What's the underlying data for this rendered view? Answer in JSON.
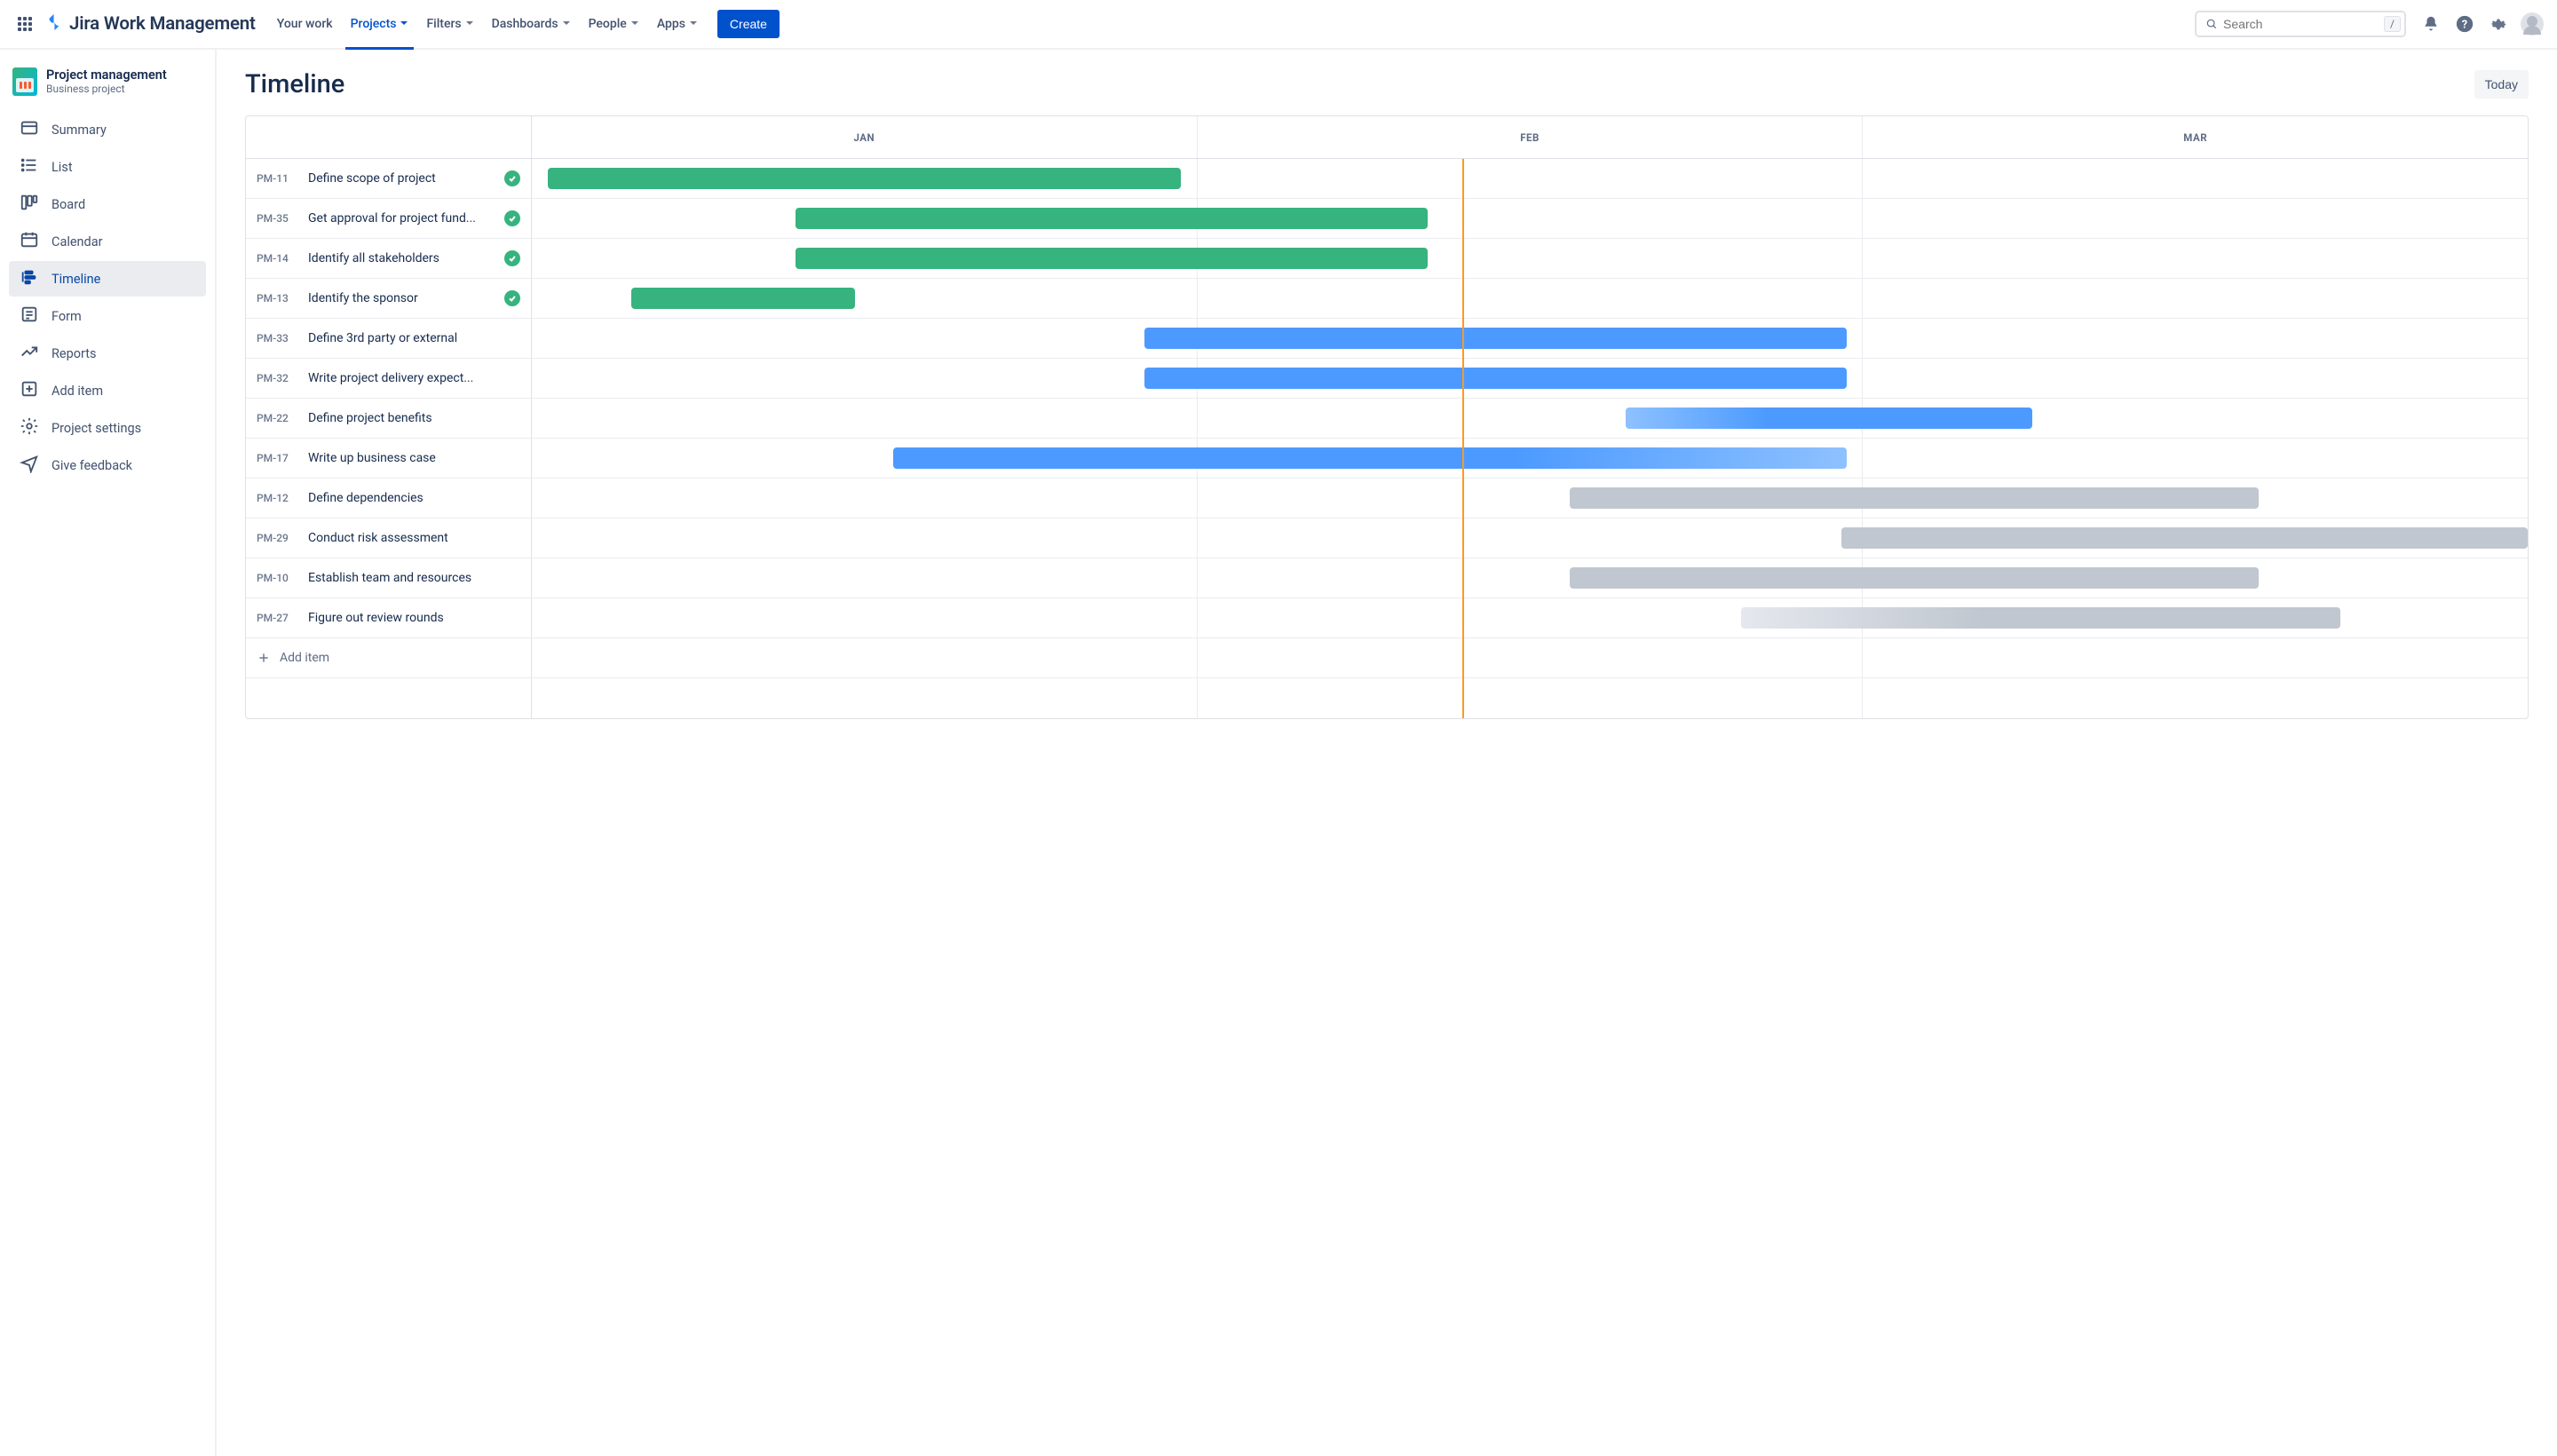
{
  "app": {
    "name": "Jira Work Management"
  },
  "nav": {
    "items": [
      {
        "label": "Your work",
        "dropdown": false
      },
      {
        "label": "Projects",
        "dropdown": true,
        "active": true
      },
      {
        "label": "Filters",
        "dropdown": true
      },
      {
        "label": "Dashboards",
        "dropdown": true
      },
      {
        "label": "People",
        "dropdown": true
      },
      {
        "label": "Apps",
        "dropdown": true
      }
    ],
    "create": "Create"
  },
  "search": {
    "placeholder": "Search",
    "shortcut": "/"
  },
  "project": {
    "name": "Project management",
    "type": "Business project"
  },
  "sidebar": {
    "items": [
      {
        "label": "Summary"
      },
      {
        "label": "List"
      },
      {
        "label": "Board"
      },
      {
        "label": "Calendar"
      },
      {
        "label": "Timeline",
        "selected": true
      },
      {
        "label": "Form"
      },
      {
        "label": "Reports"
      },
      {
        "label": "Add item"
      },
      {
        "label": "Project settings"
      },
      {
        "label": "Give feedback"
      }
    ]
  },
  "page": {
    "title": "Timeline",
    "today_btn": "Today",
    "add_item": "Add item"
  },
  "months": [
    "JAN",
    "FEB",
    "MAR"
  ],
  "today_position_pct": 46.6,
  "tasks": [
    {
      "key": "PM-11",
      "title": "Define scope of project",
      "done": true,
      "style": "green",
      "start_pct": 0.8,
      "width_pct": 31.7
    },
    {
      "key": "PM-35",
      "title": "Get approval for project fund...",
      "done": true,
      "style": "green",
      "start_pct": 13.2,
      "width_pct": 31.7
    },
    {
      "key": "PM-14",
      "title": "Identify all stakeholders",
      "done": true,
      "style": "green",
      "start_pct": 13.2,
      "width_pct": 31.7
    },
    {
      "key": "PM-13",
      "title": "Identify the sponsor",
      "done": true,
      "style": "green",
      "start_pct": 5.0,
      "width_pct": 11.2
    },
    {
      "key": "PM-33",
      "title": "Define 3rd party or external",
      "done": false,
      "style": "blue",
      "start_pct": 30.7,
      "width_pct": 35.2
    },
    {
      "key": "PM-32",
      "title": "Write project delivery expect...",
      "done": false,
      "style": "blue",
      "start_pct": 30.7,
      "width_pct": 35.2
    },
    {
      "key": "PM-22",
      "title": "Define project benefits",
      "done": false,
      "style": "blue-grad",
      "start_pct": 54.8,
      "width_pct": 20.4
    },
    {
      "key": "PM-17",
      "title": "Write up business case",
      "done": false,
      "style": "blue-fade",
      "start_pct": 18.1,
      "width_pct": 47.8
    },
    {
      "key": "PM-12",
      "title": "Define dependencies",
      "done": false,
      "style": "grey",
      "start_pct": 52.0,
      "width_pct": 34.5
    },
    {
      "key": "PM-29",
      "title": "Conduct risk assessment",
      "done": false,
      "style": "grey",
      "start_pct": 65.6,
      "width_pct": 34.4
    },
    {
      "key": "PM-10",
      "title": "Establish team and resources",
      "done": false,
      "style": "grey",
      "start_pct": 52.0,
      "width_pct": 34.5
    },
    {
      "key": "PM-27",
      "title": "Figure out review rounds",
      "done": false,
      "style": "grey-grad",
      "start_pct": 60.6,
      "width_pct": 30.0
    }
  ]
}
